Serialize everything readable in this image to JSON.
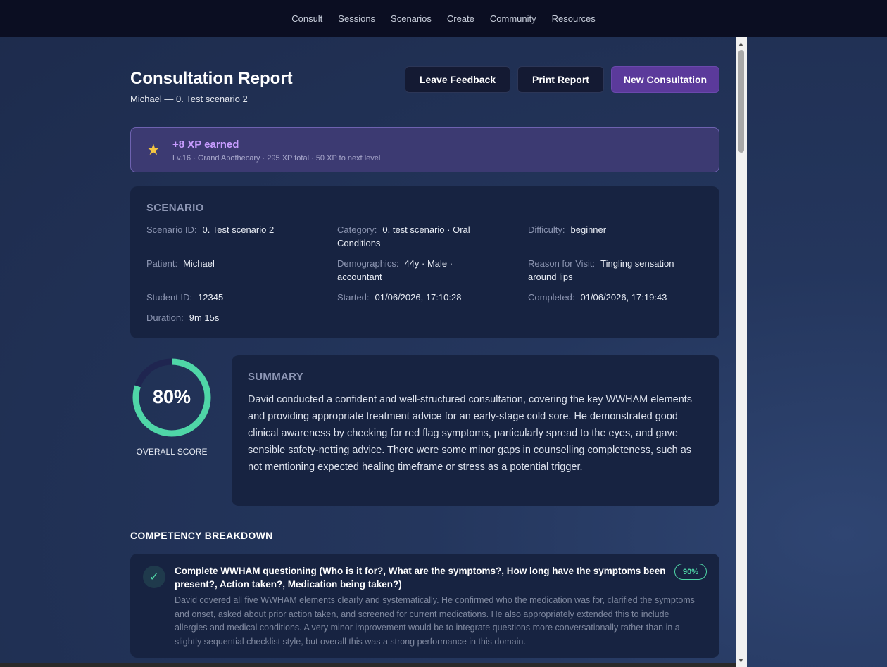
{
  "nav": {
    "items": [
      "Consult",
      "Sessions",
      "Scenarios",
      "Create",
      "Community",
      "Resources"
    ]
  },
  "header": {
    "title": "Consultation Report",
    "subtitle": "Michael — 0. Test scenario 2",
    "buttons": {
      "feedback": "Leave Feedback",
      "print": "Print Report",
      "new": "New Consultation"
    }
  },
  "xp": {
    "icon": "star-icon",
    "title": "+8 XP earned",
    "detail": "Lv.16 · Grand Apothecary · 295 XP total · 50 XP to next level"
  },
  "scenario": {
    "heading": "SCENARIO",
    "fields": [
      {
        "label": "Scenario ID:",
        "value": "0. Test scenario 2"
      },
      {
        "label": "Category:",
        "value": "0. test scenario · Oral Conditions"
      },
      {
        "label": "Difficulty:",
        "value": "beginner"
      },
      {
        "label": "Patient:",
        "value": "Michael"
      },
      {
        "label": "Demographics:",
        "value": "44y · Male · accountant"
      },
      {
        "label": "Reason for Visit:",
        "value": "Tingling sensation around lips"
      },
      {
        "label": "Student ID:",
        "value": "12345"
      },
      {
        "label": "Started:",
        "value": "01/06/2026, 17:10:28"
      },
      {
        "label": "Completed:",
        "value": "01/06/2026, 17:19:43"
      },
      {
        "label": "Duration:",
        "value": "9m 15s"
      }
    ]
  },
  "score": {
    "value": "80%",
    "fraction": 0.8,
    "label": "OVERALL SCORE",
    "ring_color": "#4fd6a7",
    "track_color": "#1f2550"
  },
  "summary": {
    "heading": "SUMMARY",
    "text": "David conducted a confident and well-structured consultation, covering the key WWHAM elements and providing appropriate treatment advice for an early-stage cold sore. He demonstrated good clinical awareness by checking for red flag symptoms, particularly spread to the eyes, and gave sensible safety-netting advice. There were some minor gaps in counselling completeness, such as not mentioning expected healing timeframe or stress as a potential trigger."
  },
  "competency": {
    "heading": "COMPETENCY BREAKDOWN",
    "items": [
      {
        "icon": "check-icon",
        "name": "Complete WWHAM questioning (Who is it for?, What are the symptoms?, How long have the symptoms been present?, Action taken?, Medication being taken?)",
        "score": "90%",
        "feedback": "David covered all five WWHAM elements clearly and systematically. He confirmed who the medication was for, clarified the symptoms and onset, asked about prior action taken, and screened for current medications. He also appropriately extended this to include allergies and medical conditions. A very minor improvement would be to integrate questions more conversationally rather than in a slightly sequential checklist style, but overall this was a strong performance in this domain."
      }
    ]
  }
}
